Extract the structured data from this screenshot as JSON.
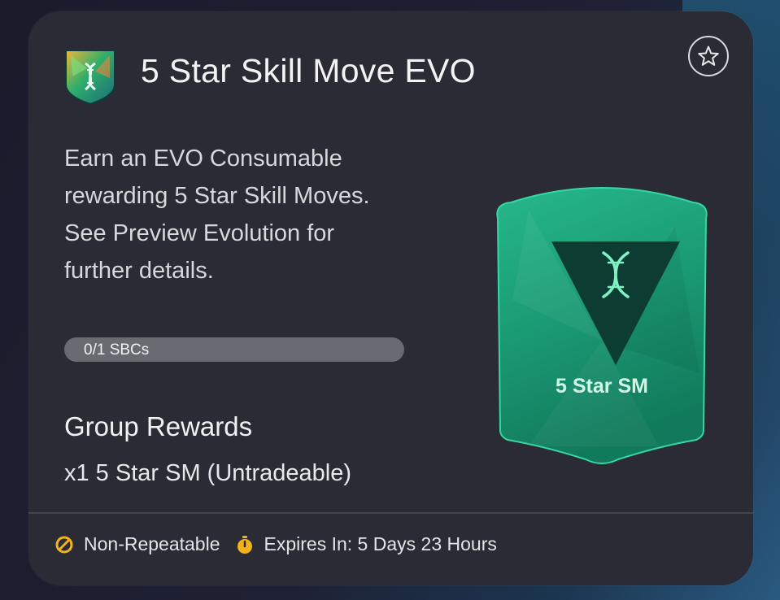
{
  "title": "5 Star Skill Move EVO",
  "description": "Earn an EVO Consumable rewarding 5 Star Skill Moves. See Preview Evolution for further details.",
  "progress": {
    "label": "0/1 SBCs",
    "completed": 0,
    "total": 1
  },
  "group_rewards": {
    "title": "Group Rewards",
    "items": [
      "x1 5 Star SM (Untradeable)"
    ]
  },
  "evo_card": {
    "label": "5 Star SM",
    "icon": "dna-icon"
  },
  "footer": {
    "repeatable_label": "Non-Repeatable",
    "expires_label": "Expires In: 5 Days 23 Hours"
  },
  "icons": {
    "badge": "evo-badge-icon",
    "favorite": "star-outline-icon",
    "repeat": "no-repeat-icon",
    "timer": "stopwatch-icon"
  },
  "colors": {
    "card_bg": "#2b2b35",
    "accent_green": "#1fa37d",
    "footer_icon": "#f2b21c",
    "text_primary": "#f3f3f5"
  }
}
